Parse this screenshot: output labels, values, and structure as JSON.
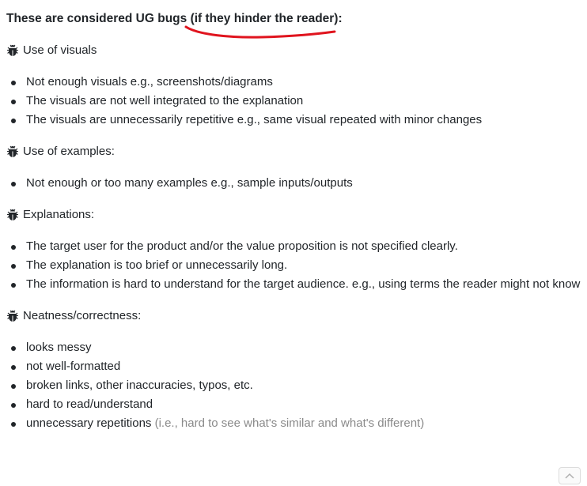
{
  "heading": {
    "prefix": "These are considered UG bugs ",
    "emphasis": "(if they hinder the reader)",
    "suffix": ":"
  },
  "sections": [
    {
      "title": "Use of visuals",
      "items": [
        "Not enough visuals e.g., screenshots/diagrams",
        "The visuals are not well integrated to the explanation",
        "The visuals are unnecessarily repetitive e.g., same visual repeated with minor changes"
      ]
    },
    {
      "title": "Use of examples:",
      "items": [
        "Not enough or too many examples e.g., sample inputs/outputs"
      ]
    },
    {
      "title": "Explanations:",
      "items": [
        "The target user for the product and/or the value proposition is not specified clearly.",
        "The explanation is too brief or unnecessarily long.",
        "The information is hard to understand for the target audience. e.g., using terms the reader might not know"
      ]
    },
    {
      "title": "Neatness/correctness:",
      "items": [
        "looks messy",
        "not well-formatted",
        "broken links, other inaccuracies, typos, etc.",
        "hard to read/understand"
      ],
      "last_item": {
        "text": "unnecessary repetitions ",
        "muted": "(i.e., hard to see what's similar and what's different)"
      }
    }
  ],
  "icons": {
    "section": "bug-icon",
    "scroll": "chevron-up-icon"
  },
  "colors": {
    "text": "#212529",
    "muted": "#8a8a8a",
    "annotation": "#e0141e"
  }
}
